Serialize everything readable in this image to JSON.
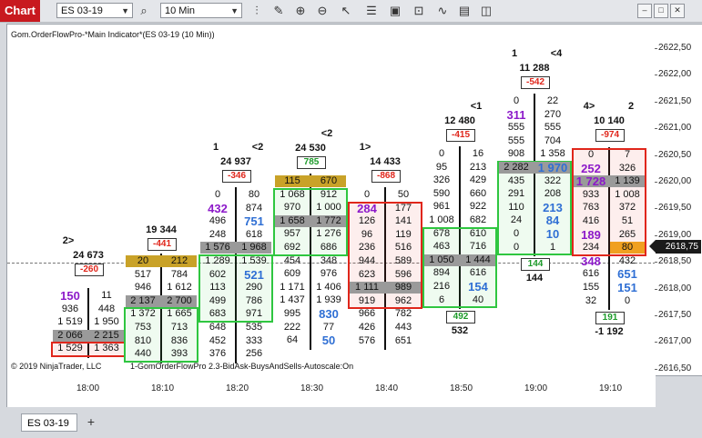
{
  "window": {
    "title": "Chart",
    "instrument": "ES 03-19",
    "interval": "10 Min"
  },
  "toolbar_icons": [
    "search-icon",
    "bar-style-icon",
    "pencil-icon",
    "zoom-in-icon",
    "zoom-out-icon",
    "pointer-icon",
    "properties-icon",
    "strategies-icon",
    "chart-trader-icon",
    "indicators-icon",
    "data-box-icon",
    "snapshot-icon"
  ],
  "indicator_label": "Gom.OrderFlowPro-*Main Indicator*(ES 03-19 (10 Min))",
  "copyright": "© 2019 NinjaTrader, LLC",
  "settings_label": "1-GomOrderFlowPro 2.3-BidAsk-BuysAndSells-Autoscale:On",
  "price_axis": [
    "2622,50",
    "2622,00",
    "2621,50",
    "2621,00",
    "2620,50",
    "2620,00",
    "2619,50",
    "2619,00",
    "2618,50",
    "2618,00",
    "2617,50",
    "2617,00",
    "2616,50"
  ],
  "last_price": "2618,75",
  "time_axis": [
    "18:00",
    "18:10",
    "18:20",
    "18:30",
    "18:40",
    "18:50",
    "19:00",
    "19:10"
  ],
  "tab": {
    "label": "ES 03-19",
    "add": "+"
  },
  "bars": [
    {
      "label": "2>",
      "volume": "24 673",
      "delta": "-260",
      "rows": [
        [
          "150",
          "11"
        ],
        [
          "936",
          "448"
        ],
        [
          "1 519",
          "1 950"
        ],
        [
          "2 066",
          "2 215"
        ],
        [
          "1 529",
          "1 363"
        ]
      ]
    },
    {
      "label": "",
      "volume": "19 344",
      "delta": "-441",
      "rows": [
        [
          "20",
          "212"
        ],
        [
          "517",
          "784"
        ],
        [
          "946",
          "1 612"
        ],
        [
          "2 137",
          "2 700"
        ],
        [
          "1 372",
          "1 665"
        ],
        [
          "753",
          "713"
        ],
        [
          "810",
          "836"
        ],
        [
          "440",
          "393"
        ]
      ]
    },
    {
      "label": "1",
      "label2": "<2",
      "volume": "24 937",
      "delta": "-346",
      "rows": [
        [
          "0",
          "80"
        ],
        [
          "432",
          "874"
        ],
        [
          "496",
          "751"
        ],
        [
          "248",
          "618"
        ],
        [
          "1 576",
          "1 968"
        ],
        [
          "1 289",
          "1 539"
        ],
        [
          "602",
          "521"
        ],
        [
          "113",
          "290"
        ],
        [
          "499",
          "786"
        ],
        [
          "683",
          "971"
        ],
        [
          "648",
          "535"
        ],
        [
          "452",
          "333"
        ],
        [
          "376",
          "256"
        ]
      ]
    },
    {
      "label": "<2",
      "volume": "24 530",
      "delta": "785",
      "rows": [
        [
          "115",
          "670"
        ],
        [
          "1 068",
          "912"
        ],
        [
          "970",
          "1 000"
        ],
        [
          "1 658",
          "1 772"
        ],
        [
          "957",
          "1 276"
        ],
        [
          "692",
          "686"
        ],
        [
          "454",
          "348"
        ],
        [
          "609",
          "976"
        ],
        [
          "1 171",
          "1 406"
        ],
        [
          "1 437",
          "1 939"
        ],
        [
          "995",
          "830"
        ],
        [
          "222",
          "77"
        ],
        [
          "64",
          "50"
        ]
      ]
    },
    {
      "label": "1>",
      "volume": "14 433",
      "delta": "-868",
      "rows": [
        [
          "0",
          "50"
        ],
        [
          "284",
          "177"
        ],
        [
          "126",
          "141"
        ],
        [
          "96",
          "119"
        ],
        [
          "236",
          "516"
        ],
        [
          "944",
          "589"
        ],
        [
          "623",
          "596"
        ],
        [
          "1 111",
          "989"
        ],
        [
          "919",
          "962"
        ],
        [
          "966",
          "782"
        ],
        [
          "426",
          "443"
        ],
        [
          "576",
          "651"
        ]
      ]
    },
    {
      "label": "<1",
      "volume": "12 480",
      "delta": "-415",
      "rows": [
        [
          "0",
          "16"
        ],
        [
          "95",
          "213"
        ],
        [
          "326",
          "429"
        ],
        [
          "590",
          "660"
        ],
        [
          "961",
          "922"
        ],
        [
          "1 008",
          "682"
        ],
        [
          "678",
          "610"
        ],
        [
          "463",
          "716"
        ],
        [
          "1 050",
          "1 444"
        ],
        [
          "894",
          "616"
        ],
        [
          "216",
          "154"
        ],
        [
          "6",
          "40"
        ]
      ],
      "delta_below": "492",
      "delta_below2": "532"
    },
    {
      "label": "1",
      "label2": "<4",
      "volume": "11 288",
      "delta": "-542",
      "rows": [
        [
          "0",
          "22"
        ],
        [
          "311",
          "270"
        ],
        [
          "555",
          "555"
        ],
        [
          "555",
          "704"
        ],
        [
          "908",
          "1 358"
        ],
        [
          "2 282",
          "1 970"
        ],
        [
          "435",
          "322"
        ],
        [
          "291",
          "208"
        ],
        [
          "110",
          "213"
        ],
        [
          "24",
          "84"
        ],
        [
          "0",
          "10"
        ],
        [
          "0",
          "1"
        ]
      ],
      "delta_below": "144",
      "delta_below2": "144"
    },
    {
      "label": "4>",
      "label2": "2",
      "volume": "10 140",
      "delta": "-974",
      "rows": [
        [
          "0",
          "7"
        ],
        [
          "252",
          "326"
        ],
        [
          "1 728",
          "1 139"
        ],
        [
          "933",
          "1 008"
        ],
        [
          "763",
          "372"
        ],
        [
          "416",
          "51"
        ],
        [
          "189",
          "265"
        ],
        [
          "234",
          "80"
        ],
        [
          "348",
          "432"
        ],
        [
          "616",
          "651"
        ],
        [
          "155",
          "151"
        ],
        [
          "32",
          "0"
        ]
      ],
      "delta_below": "191",
      "delta_below2": "-1 192"
    }
  ]
}
